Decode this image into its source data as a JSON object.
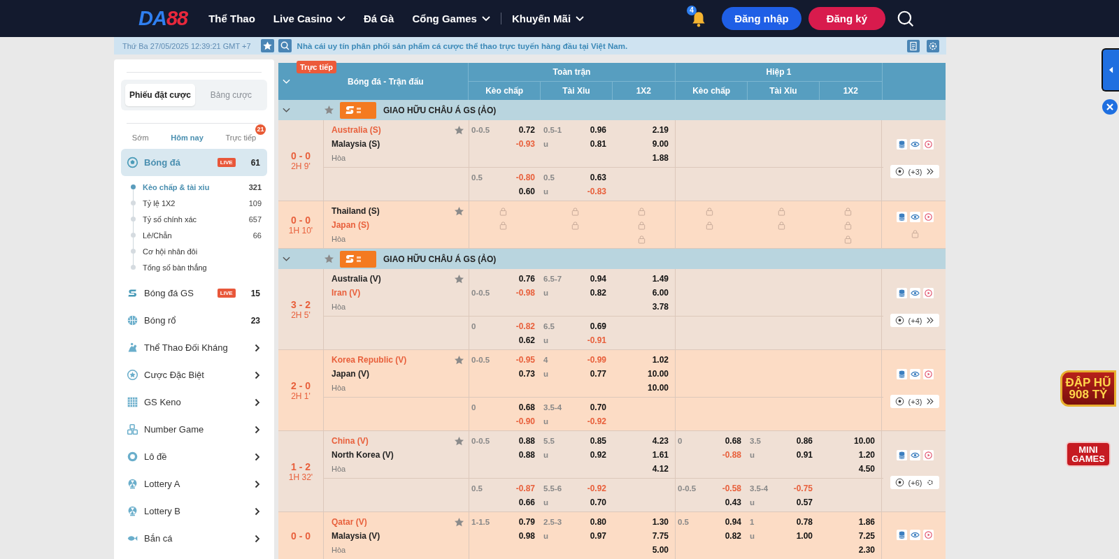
{
  "header": {
    "logo": {
      "part1": "DA",
      "part2": "88"
    },
    "nav": [
      {
        "label": "Thể Thao",
        "dropdown": false,
        "separator_before": false
      },
      {
        "label": "Live Casino",
        "dropdown": true,
        "separator_before": false
      },
      {
        "label": "Đá Gà",
        "dropdown": false,
        "separator_before": false
      },
      {
        "label": "Cổng Games",
        "dropdown": true,
        "separator_before": false
      },
      {
        "label": "Khuyến Mãi",
        "dropdown": true,
        "separator_before": true
      }
    ],
    "notifications": "4",
    "login": "Đăng nhập",
    "register": "Đăng ký"
  },
  "ticker": {
    "datetime": "Thứ Ba 27/05/2025 12:39:21 GMT +7",
    "message": "Nhà cái uy tín phân phối sản phẩm cá cược thể thao trực tuyến hàng đầu tại Việt Nam."
  },
  "sidebar": {
    "tabs": [
      {
        "label": "Phiếu đặt cược",
        "selected": true
      },
      {
        "label": "Bảng cược",
        "selected": false
      }
    ],
    "periods": [
      {
        "label": "Sớm",
        "selected": false
      },
      {
        "label": "Hôm nay",
        "selected": true
      },
      {
        "label": "Trực tiếp",
        "selected": false,
        "badge": "21"
      }
    ],
    "sports": [
      {
        "name": "Bóng đá",
        "live_badge": "LIVE",
        "count": "61",
        "selected": true,
        "children": [
          {
            "label": "Kèo chấp & tài xiu",
            "count": "321",
            "selected": true
          },
          {
            "label": "Tỷ lệ 1X2",
            "count": "109",
            "selected": false
          },
          {
            "label": "Tỷ số chính xác",
            "count": "657",
            "selected": false
          },
          {
            "label": "Lẻ/Chẵn",
            "count": "66",
            "selected": false
          },
          {
            "label": "Cơ hội nhân đôi",
            "selected": false
          },
          {
            "label": "Tổng số bàn thắng",
            "selected": false
          }
        ]
      },
      {
        "name": "Bóng đá GS",
        "live_badge": "LIVE",
        "count": "15",
        "selected": false
      },
      {
        "name": "Bóng rổ",
        "count": "23",
        "selected": false
      },
      {
        "name": "Thể Thao Đối Kháng",
        "selected": false
      },
      {
        "name": "Cược Đặc Biệt",
        "selected": false
      },
      {
        "name": "GS Keno",
        "selected": false
      },
      {
        "name": "Number Game",
        "selected": false
      },
      {
        "name": "Lô đề",
        "selected": false
      },
      {
        "name": "Lottery A",
        "selected": false
      },
      {
        "name": "Lottery B",
        "selected": false
      },
      {
        "name": "Bắn cá",
        "selected": false
      }
    ]
  },
  "table": {
    "live_badge": "Trực tiếp",
    "title": "Bóng đá - Trận đấu",
    "periods": [
      {
        "label": "Toàn trận",
        "columns": [
          "Kèo chấp",
          "Tài Xỉu",
          "1X2"
        ]
      },
      {
        "label": "Hiệp 1",
        "columns": [
          "Kèo chấp",
          "Tài Xỉu",
          "1X2"
        ]
      }
    ],
    "leagues": [
      {
        "name": "GIAO HỮU CHÂU Á GS (ẢO)",
        "matches": [
          {
            "kind": "open",
            "score": "0 - 0",
            "time": "2H 9'",
            "teams": [
              {
                "name": "Australia (S)",
                "favorite": true
              },
              {
                "name": "Malaysia (S)",
                "favorite": false
              }
            ],
            "draw": "Hòa",
            "lines": [
              {
                "ft": {
                  "hdp": {
                    "line": "0-0.5",
                    "line_on_away": false,
                    "home": "0.72",
                    "away": "-0.93"
                  },
                  "ou": {
                    "line": "0.5-1",
                    "over": "0.96",
                    "under_label": "u",
                    "under": "0.81"
                  },
                  "x12": [
                    "2.19",
                    "9.00",
                    "1.88"
                  ]
                }
              },
              {
                "ft": {
                  "hdp": {
                    "line": "0.5",
                    "line_on_away": false,
                    "home": "-0.80",
                    "away": "0.60"
                  },
                  "ou": {
                    "line": "0.5",
                    "over": "0.63",
                    "under_label": "u",
                    "under": "-0.83"
                  }
                }
              }
            ],
            "more": {
              "label": "(+3)",
              "kind": "arrows"
            }
          },
          {
            "kind": "locked",
            "score": "0 - 0",
            "time": "1H 10'",
            "teams": [
              {
                "name": "Thailand (S)",
                "favorite": false
              },
              {
                "name": "Japan (S)",
                "favorite": true
              }
            ],
            "draw": "Hòa"
          }
        ]
      },
      {
        "name": "GIAO HỮU CHÂU Á GS (ẢO)",
        "matches": [
          {
            "kind": "open",
            "score": "3 - 2",
            "time": "2H 5'",
            "teams": [
              {
                "name": "Australia (V)",
                "favorite": false
              },
              {
                "name": "Iran (V)",
                "favorite": true
              }
            ],
            "draw": "Hòa",
            "lines": [
              {
                "ft": {
                  "hdp": {
                    "line": "0-0.5",
                    "line_on_away": true,
                    "home": "0.76",
                    "away": "-0.98"
                  },
                  "ou": {
                    "line": "6.5-7",
                    "over": "0.94",
                    "under_label": "u",
                    "under": "0.82"
                  },
                  "x12": [
                    "1.49",
                    "6.00",
                    "3.78"
                  ]
                }
              },
              {
                "ft": {
                  "hdp": {
                    "line": "0",
                    "line_on_away": false,
                    "home": "-0.82",
                    "away": "0.62"
                  },
                  "ou": {
                    "line": "6.5",
                    "over": "0.69",
                    "under_label": "u",
                    "under": "-0.91"
                  }
                }
              }
            ],
            "more": {
              "label": "(+4)",
              "kind": "arrows"
            }
          },
          {
            "kind": "open",
            "score": "2 - 0",
            "time": "2H 1'",
            "teams": [
              {
                "name": "Korea Republic (V)",
                "favorite": true
              },
              {
                "name": "Japan (V)",
                "favorite": false
              }
            ],
            "draw": "Hòa",
            "lines": [
              {
                "ft": {
                  "hdp": {
                    "line": "0-0.5",
                    "line_on_away": false,
                    "home": "-0.95",
                    "away": "0.73"
                  },
                  "ou": {
                    "line": "4",
                    "over": "-0.99",
                    "under_label": "u",
                    "under": "0.77"
                  },
                  "x12": [
                    "1.02",
                    "10.00",
                    "10.00"
                  ]
                }
              },
              {
                "ft": {
                  "hdp": {
                    "line": "0",
                    "line_on_away": false,
                    "home": "0.68",
                    "away": "-0.90"
                  },
                  "ou": {
                    "line": "3.5-4",
                    "over": "0.70",
                    "under_label": "u",
                    "under": "-0.92"
                  }
                }
              }
            ],
            "more": {
              "label": "(+3)",
              "kind": "arrows"
            }
          },
          {
            "kind": "open",
            "score": "1 - 2",
            "time": "1H 32'",
            "teams": [
              {
                "name": "China (V)",
                "favorite": true
              },
              {
                "name": "North Korea (V)",
                "favorite": false
              }
            ],
            "draw": "Hòa",
            "lines": [
              {
                "ft": {
                  "hdp": {
                    "line": "0-0.5",
                    "line_on_away": false,
                    "home": "0.88",
                    "away": "0.88"
                  },
                  "ou": {
                    "line": "5.5",
                    "over": "0.85",
                    "under_label": "u",
                    "under": "0.92"
                  },
                  "x12": [
                    "4.23",
                    "1.61",
                    "4.12"
                  ]
                },
                "h1": {
                  "hdp": {
                    "line": "0",
                    "line_on_away": false,
                    "home": "0.68",
                    "away": "-0.88"
                  },
                  "ou": {
                    "line": "3.5",
                    "over": "0.86",
                    "under_label": "u",
                    "under": "0.91"
                  },
                  "x12": [
                    "10.00",
                    "1.20",
                    "4.50"
                  ]
                }
              },
              {
                "ft": {
                  "hdp": {
                    "line": "0.5",
                    "line_on_away": false,
                    "home": "-0.87",
                    "away": "0.66"
                  },
                  "ou": {
                    "line": "5.5-6",
                    "over": "-0.92",
                    "under_label": "u",
                    "under": "0.70"
                  }
                },
                "h1": {
                  "hdp": {
                    "line": "0-0.5",
                    "line_on_away": false,
                    "home": "-0.58",
                    "away": "0.43"
                  },
                  "ou": {
                    "line": "3.5-4",
                    "over": "-0.75",
                    "under_label": "u",
                    "under": "0.57"
                  }
                }
              }
            ],
            "more": {
              "label": "(+6)",
              "kind": "spinner"
            }
          },
          {
            "kind": "open",
            "score": "0 - 0",
            "teams": [
              {
                "name": "Qatar (V)",
                "favorite": true
              },
              {
                "name": "Malaysia (V)",
                "favorite": false
              }
            ],
            "draw": "Hòa",
            "lines": [
              {
                "ft": {
                  "hdp": {
                    "line": "1-1.5",
                    "line_on_away": false,
                    "home": "0.79",
                    "away": "0.98"
                  },
                  "ou": {
                    "line": "2.5-3",
                    "over": "0.80",
                    "under_label": "u",
                    "under": "0.97"
                  },
                  "x12": [
                    "1.30",
                    "7.75",
                    "5.00"
                  ]
                },
                "h1": {
                  "hdp": {
                    "line": "0.5",
                    "line_on_away": false,
                    "home": "0.94",
                    "away": "0.82"
                  },
                  "ou": {
                    "line": "1",
                    "over": "0.78",
                    "under_label": "u",
                    "under": "1.00"
                  },
                  "x12": [
                    "1.86",
                    "7.25",
                    "2.30"
                  ]
                }
              }
            ]
          }
        ]
      }
    ]
  },
  "promos": [
    {
      "line1": "ĐẬP HŨ",
      "line2": "908 TỶ"
    },
    {
      "line1": "MINI",
      "line2": "GAMES"
    }
  ]
}
